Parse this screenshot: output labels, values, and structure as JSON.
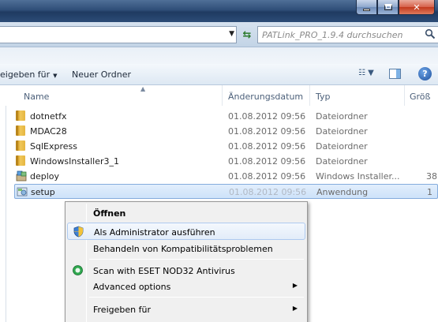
{
  "search": {
    "placeholder": "PATLink_PRO_1.9.4 durchsuchen"
  },
  "toolbar": {
    "share_label": "eigeben für",
    "new_folder_label": "Neuer Ordner"
  },
  "columns": {
    "name": "Name",
    "date": "Änderungsdatum",
    "type": "Typ",
    "size": "Größ"
  },
  "files": [
    {
      "name": "dotnetfx",
      "date": "01.08.2012 09:56",
      "type": "Dateiordner",
      "size": "",
      "icon": "folder-icon"
    },
    {
      "name": "MDAC28",
      "date": "01.08.2012 09:56",
      "type": "Dateiordner",
      "size": "",
      "icon": "folder-icon"
    },
    {
      "name": "SqlExpress",
      "date": "01.08.2012 09:56",
      "type": "Dateiordner",
      "size": "",
      "icon": "folder-icon"
    },
    {
      "name": "WindowsInstaller3_1",
      "date": "01.08.2012 09:56",
      "type": "Dateiordner",
      "size": "",
      "icon": "folder-icon"
    },
    {
      "name": "deploy",
      "date": "01.08.2012 09:56",
      "type": "Windows Installer...",
      "size": "38",
      "icon": "msi-icon"
    },
    {
      "name": "setup",
      "date": "01.08.2012 09:56",
      "type": "Anwendung",
      "size": "1",
      "icon": "setup-exe-icon"
    }
  ],
  "context_menu": {
    "open": "Öffnen",
    "run_as_admin": "Als Administrator ausführen",
    "compat": "Behandeln von Kompatibilitätsproblemen",
    "eset_scan": "Scan with ESET NOD32 Antivirus",
    "advanced": "Advanced options",
    "share": "Freigeben für"
  },
  "colors": {
    "title_bar": "#2f4e78",
    "selection": "#cde2f9",
    "close_button": "#c2391d"
  }
}
